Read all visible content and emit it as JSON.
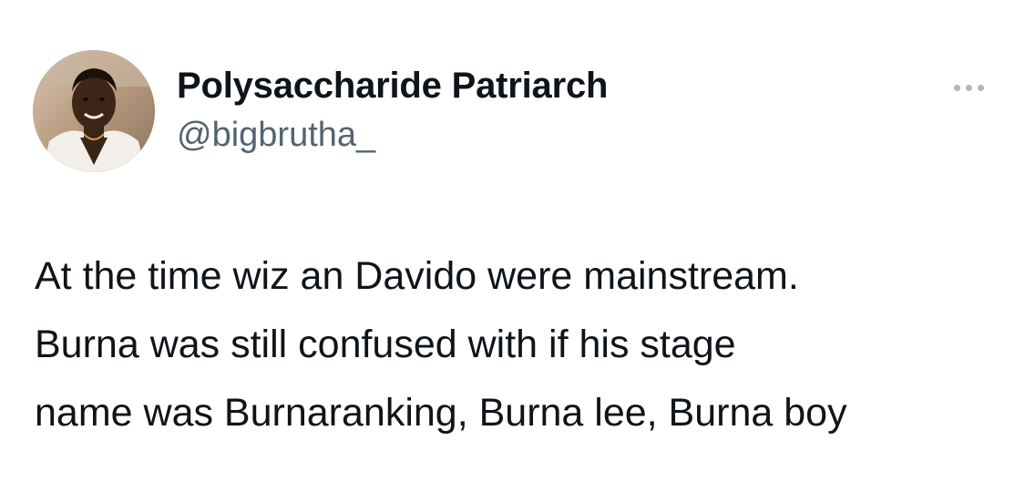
{
  "author": {
    "display_name": "Polysaccharide Patriarch",
    "handle": "@bigbrutha_",
    "avatar_icon": "user-avatar-photo"
  },
  "more_icon": "more-horizontal-icon",
  "tweet": {
    "lines": [
      "At the time wiz an Davido were mainstream.",
      "Burna was still confused with if his stage",
      "name was Burnaranking, Burna lee, Burna boy"
    ]
  },
  "colors": {
    "text": "#0f1419",
    "secondary": "#536471",
    "more_dots": "#aab8c2",
    "background": "#ffffff"
  }
}
